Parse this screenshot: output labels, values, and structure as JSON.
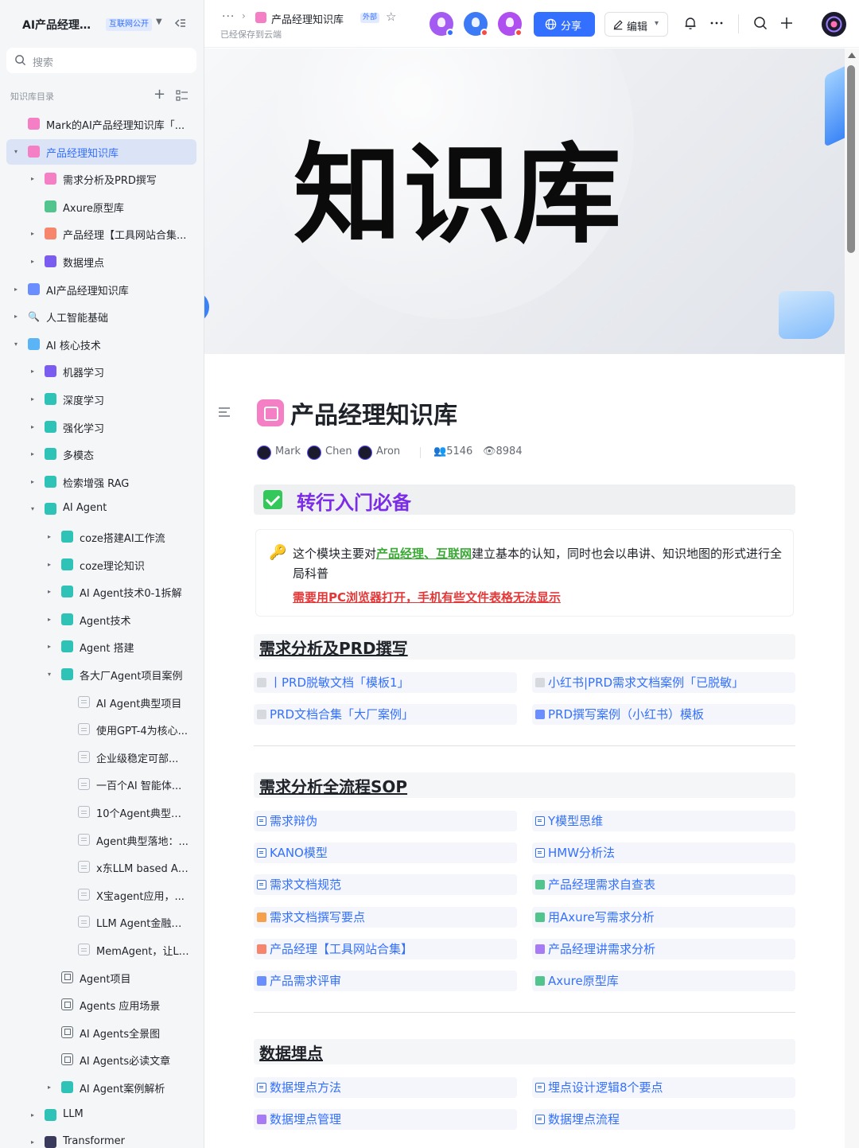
{
  "sidebar": {
    "title": "AI产品经理知...",
    "badge": "互联网公开",
    "search_placeholder": "搜索",
    "section_label": "知识库目录",
    "items": [
      {
        "label": "Mark的AI产品经理知识库「...",
        "icon": "pink"
      },
      {
        "label": "产品经理知识库",
        "icon": "pink"
      },
      {
        "label": "需求分析及PRD撰写",
        "icon": "pink"
      },
      {
        "label": "Axure原型库",
        "icon": "green"
      },
      {
        "label": "产品经理【工具网站合集...",
        "icon": "orange"
      },
      {
        "label": "数据埋点",
        "icon": "purple"
      },
      {
        "label": "AI产品经理知识库",
        "icon": "blue"
      },
      {
        "label": "人工智能基础",
        "icon": "search"
      },
      {
        "label": "AI 核心技术",
        "icon": "globe"
      },
      {
        "label": "机器学习",
        "icon": "robot"
      },
      {
        "label": "深度学习",
        "icon": "teal"
      },
      {
        "label": "强化学习",
        "icon": "teal"
      },
      {
        "label": "多模态",
        "icon": "teal"
      },
      {
        "label": "检索增强 RAG",
        "icon": "teal"
      },
      {
        "label": "AI Agent",
        "icon": "teal"
      },
      {
        "label": "coze搭建AI工作流",
        "icon": "teal"
      },
      {
        "label": "coze理论知识",
        "icon": "teal"
      },
      {
        "label": "AI Agent技术0-1拆解",
        "icon": "teal"
      },
      {
        "label": "Agent技术",
        "icon": "teal"
      },
      {
        "label": "Agent 搭建",
        "icon": "teal"
      },
      {
        "label": "各大厂Agent项目案例",
        "icon": "teal"
      },
      {
        "label": "AI Agent典型项目",
        "icon": "doc"
      },
      {
        "label": "使用GPT-4为核心...",
        "icon": "doc"
      },
      {
        "label": "企业级稳定可部...",
        "icon": "doc"
      },
      {
        "label": "一百个AI 智能体...",
        "icon": "doc"
      },
      {
        "label": "10个Agent典型应...",
        "icon": "doc"
      },
      {
        "label": "Agent典型落地：...",
        "icon": "doc"
      },
      {
        "label": "x东LLM based Ag...",
        "icon": "doc"
      },
      {
        "label": "X宝agent应用，...",
        "icon": "doc"
      },
      {
        "label": "LLM Agent金融领...",
        "icon": "doc"
      },
      {
        "label": "MemAgent，让LL...",
        "icon": "doc"
      },
      {
        "label": "Agent项目",
        "icon": "db"
      },
      {
        "label": "Agents 应用场景",
        "icon": "db"
      },
      {
        "label": "AI Agents全景图",
        "icon": "db"
      },
      {
        "label": "AI Agents必读文章",
        "icon": "db"
      },
      {
        "label": "AI Agent案例解析",
        "icon": "teal"
      },
      {
        "label": "LLM",
        "icon": "teal"
      },
      {
        "label": "Transformer",
        "icon": "save"
      }
    ]
  },
  "topbar": {
    "breadcrumb_title": "产品经理知识库",
    "external_badge": "外部",
    "saved_text": "已经保存到云端",
    "share_label": "分享",
    "edit_label": "编辑"
  },
  "doc": {
    "cover_text": "知识库",
    "title": "产品经理知识库",
    "authors": [
      "Mark",
      "Chen",
      "Aron"
    ],
    "members": "5146",
    "views": "8984",
    "banner_title": "转行入门必备",
    "callout_pre": "这个模块主要对",
    "callout_hl": "产品经理、互联网",
    "callout_post": "建立基本的认知，同时也会以串讲、知识地图的形式进行全局科普",
    "callout_warn": "需要用PC浏览器打开，手机有些文件表格无法显示"
  },
  "sections": [
    {
      "title": "需求分析及PRD撰写",
      "links": [
        {
          "text": "丨PRD脱敏文档「模板1」",
          "icon": "gray"
        },
        {
          "text": "小红书|PRD需求文档案例「已脱敏」",
          "icon": "gray"
        },
        {
          "text": "PRD文档合集「大厂案例」",
          "icon": "gray"
        },
        {
          "text": "PRD撰写案例（小红书）模板",
          "icon": "blue"
        }
      ]
    },
    {
      "title": "需求分析全流程SOP",
      "links": [
        {
          "text": "需求辩伪",
          "icon": "doc"
        },
        {
          "text": "Y模型思维",
          "icon": "doc"
        },
        {
          "text": "KANO模型",
          "icon": "doc"
        },
        {
          "text": "HMW分析法",
          "icon": "doc"
        },
        {
          "text": "需求文档规范",
          "icon": "doc"
        },
        {
          "text": "产品经理需求自查表",
          "icon": "green"
        },
        {
          "text": "需求文档撰写要点",
          "icon": "orange"
        },
        {
          "text": "用Axure写需求分析",
          "icon": "green"
        },
        {
          "text": "产品经理【工具网站合集】",
          "icon": "red"
        },
        {
          "text": "产品经理讲需求分析",
          "icon": "purple"
        },
        {
          "text": "产品需求评审",
          "icon": "blue"
        },
        {
          "text": "Axure原型库",
          "icon": "green"
        }
      ]
    },
    {
      "title": "数据埋点",
      "links": [
        {
          "text": "数据埋点方法",
          "icon": "doc"
        },
        {
          "text": "埋点设计逻辑8个要点",
          "icon": "doc"
        },
        {
          "text": "数据埋点管理",
          "icon": "purple"
        },
        {
          "text": "数据埋点流程",
          "icon": "doc"
        }
      ]
    }
  ],
  "colors": {
    "accent": "#3370ff",
    "banner_title": "#7a2ce8",
    "highlight_green": "#3aaa35",
    "warning_red": "#e43838"
  }
}
